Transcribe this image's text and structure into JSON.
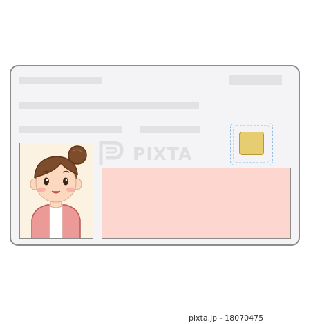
{
  "watermark": {
    "text": "PIXTA"
  },
  "credit": {
    "text": "pixta.jp - 18070475"
  },
  "card": {
    "chip_icon": "ic-chip-icon",
    "photo_icon": "woman-portrait-icon"
  },
  "colors": {
    "card_background": "#f4f4f6",
    "card_border": "#8c8c8c",
    "placeholder_bars": "#e2e2e4",
    "chip_gold": "#e6cd70",
    "chip_frame_blue": "#8fbfe8",
    "photo_background": "#fbf2e2",
    "pink_field": "#fdd6d0"
  }
}
